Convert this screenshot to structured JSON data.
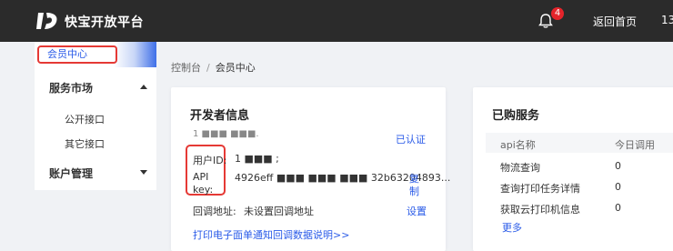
{
  "header": {
    "brand": "快宝开放平台",
    "notification_count": "4",
    "nav_home": "返回首页",
    "user_partial": "13"
  },
  "sidebar": {
    "active_item": "会员中心",
    "groups": [
      {
        "label": "服务市场",
        "expanded": true,
        "children": [
          "公开接口",
          "其它接口"
        ]
      },
      {
        "label": "账户管理",
        "expanded": false,
        "children": []
      }
    ]
  },
  "breadcrumb": {
    "parent": "控制台",
    "separator": "/",
    "current": "会员中心"
  },
  "developer_card": {
    "title": "开发者信息",
    "name_masked": "1 ■■■ ■■■.",
    "verified_label": "已认证",
    "user_id_label": "用户ID:",
    "user_id_value": "1 ■■■ ;",
    "api_key_label_line1": "API",
    "api_key_label_line2": "key:",
    "api_key_value": "4926eff ■■■ ■■■ ■■■ 32b63204893...",
    "copy_label_line1": "复",
    "copy_label_line2": "制",
    "callback_label": "回调地址:",
    "callback_value": "未设置回调地址",
    "callback_action": "设置",
    "doc_link": "打印电子面单通知回调数据说明>>"
  },
  "services_card": {
    "title": "已购服务",
    "columns": [
      "api名称",
      "今日调用"
    ],
    "rows": [
      {
        "name": "物流查询",
        "count": "0"
      },
      {
        "name": "查询打印任务详情",
        "count": "0"
      },
      {
        "name": "获取云打印机信息",
        "count": "0"
      }
    ],
    "more_link": "更多"
  },
  "colors": {
    "topbar": "#2b2b2b",
    "accent_blue": "#2a5be8",
    "highlight_red": "#e53935",
    "badge_red": "#e5242b"
  },
  "icons": [
    "kuaibao-logo-icon",
    "bell-icon",
    "caret-up-icon",
    "caret-down-icon"
  ]
}
